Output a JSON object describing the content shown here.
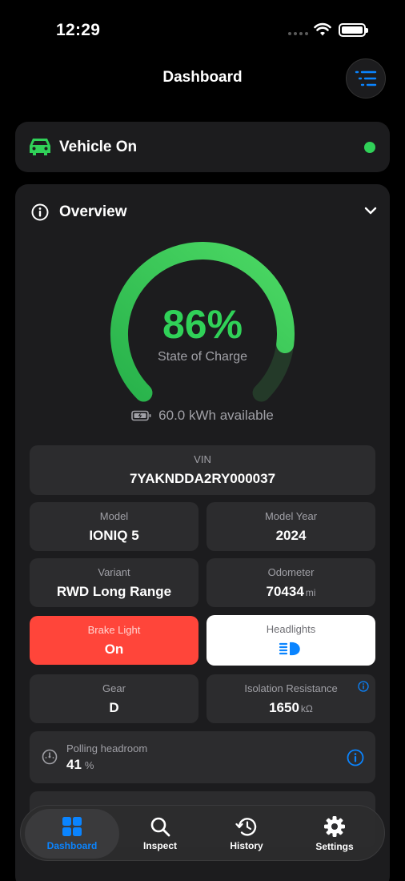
{
  "status": {
    "time": "12:29"
  },
  "header": {
    "title": "Dashboard",
    "menu_icon": "list-icon"
  },
  "vehicle": {
    "label": "Vehicle On",
    "status_color": "#30d158"
  },
  "overview": {
    "title": "Overview",
    "soc": {
      "value_text": "86%",
      "value": 86,
      "label": "State of Charge",
      "color": "#30d158"
    },
    "energy": "60.0 kWh available",
    "vin": {
      "label": "VIN",
      "value": "7YAKNDDA2RY000037"
    },
    "model": {
      "label": "Model",
      "value": "IONIQ 5"
    },
    "model_year": {
      "label": "Model Year",
      "value": "2024"
    },
    "variant": {
      "label": "Variant",
      "value": "RWD Long Range"
    },
    "odometer": {
      "label": "Odometer",
      "value": "70434",
      "unit": "mi"
    },
    "brake_light": {
      "label": "Brake Light",
      "value": "On",
      "color": "#ff453a"
    },
    "headlights": {
      "label": "Headlights",
      "icon": "headlight-icon"
    },
    "gear": {
      "label": "Gear",
      "value": "D"
    },
    "isolation": {
      "label": "Isolation Resistance",
      "value": "1650",
      "unit": "kΩ"
    },
    "polling": {
      "label": "Polling headroom",
      "value": "41",
      "unit": "%"
    }
  },
  "tabs": [
    {
      "label": "Dashboard",
      "icon": "grid-icon",
      "active": true
    },
    {
      "label": "Inspect",
      "icon": "magnifier-icon",
      "active": false
    },
    {
      "label": "History",
      "icon": "history-clock-icon",
      "active": false
    },
    {
      "label": "Settings",
      "icon": "gear-icon",
      "active": false
    }
  ],
  "colors": {
    "accent": "#0a84ff",
    "green": "#30d158",
    "red": "#ff453a",
    "card": "#1c1c1e",
    "tile": "#2c2c2e"
  }
}
